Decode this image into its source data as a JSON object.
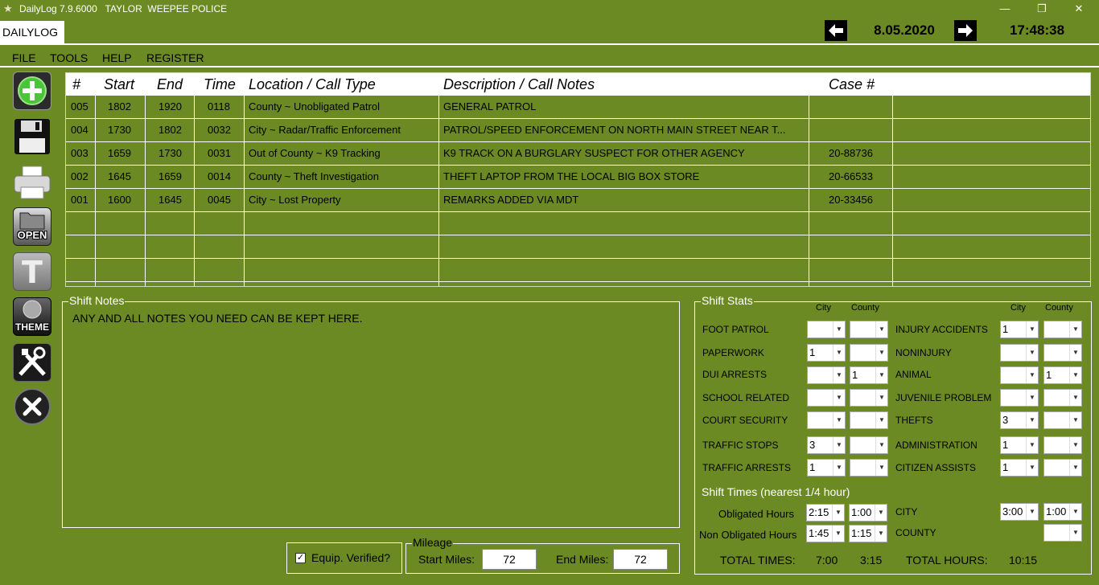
{
  "window": {
    "title": "DailyLog 7.9.6000   TAYLOR  WEEPEE POLICE",
    "min_glyph": "—",
    "restore_glyph": "❐",
    "close_glyph": "✕"
  },
  "tab": {
    "label": "DAILYLOG"
  },
  "nav": {
    "date": "8.05.2020",
    "time": "17:48:38",
    "prev_glyph": "🡐",
    "next_glyph": "🡒"
  },
  "menu": {
    "items": [
      "FILE",
      "TOOLS",
      "HELP",
      "REGISTER"
    ]
  },
  "toolbar": {
    "open_label": "OPEN",
    "text_label": "T",
    "theme_label": "THEME"
  },
  "table": {
    "columns": [
      "#",
      "Start",
      "End",
      "Time",
      "Location / Call Type",
      "Description / Call Notes",
      "Case #"
    ],
    "rows": [
      [
        "005",
        "1802",
        "1920",
        "0118",
        "County ~ Unobligated Patrol",
        "GENERAL PATROL",
        ""
      ],
      [
        "004",
        "1730",
        "1802",
        "0032",
        "City ~ Radar/Traffic Enforcement",
        "PATROL/SPEED ENFORCEMENT ON NORTH MAIN STREET NEAR T...",
        ""
      ],
      [
        "003",
        "1659",
        "1730",
        "0031",
        "Out of County ~ K9 Tracking",
        "K9 TRACK ON A BURGLARY SUSPECT FOR OTHER AGENCY",
        "20-88736"
      ],
      [
        "002",
        "1645",
        "1659",
        "0014",
        "County ~ Theft Investigation",
        "THEFT LAPTOP FROM THE LOCAL BIG BOX STORE",
        "20-66533"
      ],
      [
        "001",
        "1600",
        "1645",
        "0045",
        "City ~ Lost Property",
        "REMARKS ADDED VIA MDT",
        "20-33456"
      ]
    ]
  },
  "shift_notes": {
    "label": "Shift Notes",
    "text": "ANY AND ALL NOTES YOU NEED CAN BE KEPT HERE."
  },
  "equip": {
    "label": "Equip. Verified?",
    "checked": true
  },
  "mileage": {
    "label": "Mileage",
    "start_label": "Start Miles:",
    "start_value": "72",
    "end_label": "End Miles:",
    "end_value": "72"
  },
  "stats": {
    "label": "Shift Stats",
    "city_hdr": "City",
    "county_hdr": "County",
    "left": [
      {
        "label": "FOOT PATROL",
        "city": "",
        "county": ""
      },
      {
        "label": "PAPERWORK",
        "city": "1",
        "county": ""
      },
      {
        "label": "DUI ARRESTS",
        "city": "",
        "county": "1"
      },
      {
        "label": "SCHOOL RELATED",
        "city": "",
        "county": ""
      },
      {
        "label": "COURT SECURITY",
        "city": "",
        "county": ""
      },
      {
        "label": "TRAFFIC STOPS",
        "city": "3",
        "county": ""
      },
      {
        "label": "TRAFFIC ARRESTS",
        "city": "1",
        "county": ""
      }
    ],
    "right": [
      {
        "label": "INJURY ACCIDENTS",
        "city": "1",
        "county": ""
      },
      {
        "label": "NONINJURY",
        "city": "",
        "county": ""
      },
      {
        "label": "ANIMAL",
        "city": "",
        "county": "1"
      },
      {
        "label": "JUVENILE PROBLEM",
        "city": "",
        "county": ""
      },
      {
        "label": "THEFTS",
        "city": "3",
        "county": ""
      },
      {
        "label": "ADMINISTRATION",
        "city": "1",
        "county": ""
      },
      {
        "label": "CITIZEN ASSISTS",
        "city": "1",
        "county": ""
      }
    ],
    "shift_times_label": "Shift Times (nearest 1/4 hour)",
    "obligated": {
      "label": "Obligated Hours",
      "a": "2:15",
      "b": "1:00"
    },
    "non_obligated": {
      "label": "Non Obligated Hours",
      "a": "1:45",
      "b": "1:15"
    },
    "city": {
      "label": "CITY",
      "a": "3:00",
      "b": "1:00"
    },
    "county": {
      "label": "COUNTY",
      "b": ""
    },
    "total_times_label": "TOTAL TIMES:",
    "total_a": "7:00",
    "total_b": "3:15",
    "total_hours_label": "TOTAL HOURS:",
    "total_hours": "10:15"
  }
}
